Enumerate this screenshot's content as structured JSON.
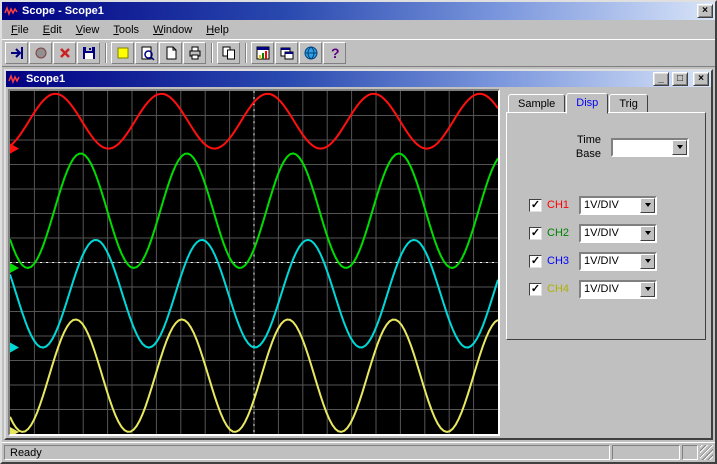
{
  "window": {
    "title": "Scope - Scope1",
    "controls": {
      "close": "×"
    }
  },
  "menu": {
    "items": [
      "File",
      "Edit",
      "View",
      "Tools",
      "Window",
      "Help"
    ]
  },
  "toolbar": {
    "buttons": [
      "exit",
      "record",
      "delete",
      "save",
      "|",
      "bookmark",
      "preview",
      "page",
      "print",
      "|",
      "copy",
      "|",
      "chart",
      "windows",
      "web-help",
      "help"
    ]
  },
  "child_window": {
    "title": "Scope1",
    "controls": {
      "minimize": "_",
      "maximize": "□",
      "close": "×"
    }
  },
  "panel": {
    "tabs": [
      {
        "label": "Sample",
        "active": false
      },
      {
        "label": "Disp",
        "active": true
      },
      {
        "label": "Trig",
        "active": false
      }
    ],
    "active_tab_color": "#0000ff",
    "timebase": {
      "label": "Time Base",
      "value": ""
    },
    "channels": [
      {
        "label": "CH1",
        "checked": true,
        "color": "#ff0000",
        "scale": "1V/DIV"
      },
      {
        "label": "CH2",
        "checked": true,
        "color": "#008000",
        "scale": "1V/DIV"
      },
      {
        "label": "CH3",
        "checked": true,
        "color": "#0000ff",
        "scale": "1V/DIV"
      },
      {
        "label": "CH4",
        "checked": true,
        "color": "#b0b000",
        "scale": "1V/DIV"
      }
    ]
  },
  "scope": {
    "background": "#000000",
    "grid": {
      "cols": 20,
      "rows": 14,
      "color": "#545454",
      "center_line_color": "#ffffff"
    },
    "waves": [
      {
        "name": "CH1",
        "color": "#ff1010",
        "center": 0.088,
        "amplitude": 0.08,
        "cycles": 4.6,
        "phase_deg": -64
      },
      {
        "name": "CH2",
        "color": "#00dc00",
        "center": 0.349,
        "amplitude": 0.167,
        "cycles": 4.6,
        "phase_deg": -150
      },
      {
        "name": "CH3",
        "color": "#00d8d8",
        "center": 0.591,
        "amplitude": 0.157,
        "cycles": 4.6,
        "phase_deg": -201
      },
      {
        "name": "CH4",
        "color": "#e8e860",
        "center": 0.83,
        "amplitude": 0.164,
        "cycles": 4.6,
        "phase_deg": -133
      }
    ]
  },
  "statusbar": {
    "text": "Ready"
  }
}
